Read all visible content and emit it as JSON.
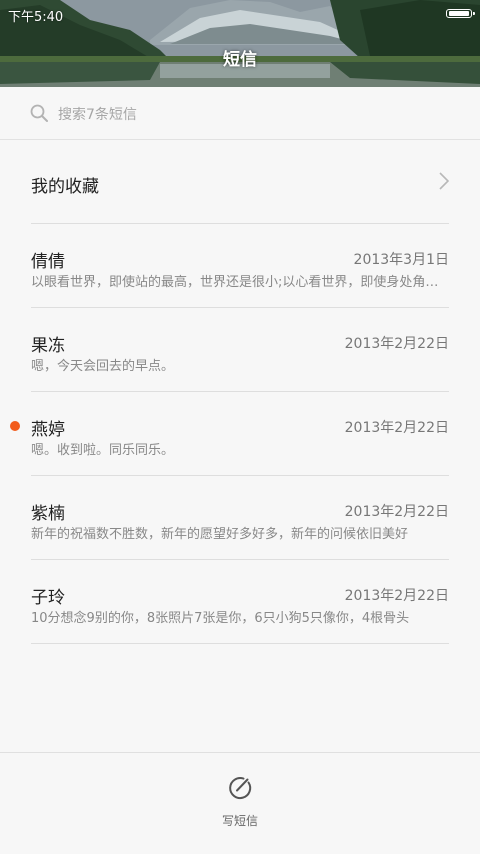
{
  "status": {
    "time": "下午5:40"
  },
  "header": {
    "title": "短信"
  },
  "search": {
    "placeholder": "搜索7条短信"
  },
  "favorites": {
    "label": "我的收藏"
  },
  "threads": [
    {
      "name": "倩倩",
      "date": "2013年3月1日",
      "preview": "以眼看世界，即使站的最高，世界还是很小;以心看世界，即使身处角落，世界也很大",
      "unread": false
    },
    {
      "name": "果冻",
      "date": "2013年2月22日",
      "preview": "嗯，今天会回去的早点。",
      "unread": false
    },
    {
      "name": "燕婷",
      "date": "2013年2月22日",
      "preview": "嗯。收到啦。同乐同乐。",
      "unread": true
    },
    {
      "name": "紫楠",
      "date": "2013年2月22日",
      "preview": "新年的祝福数不胜数，新年的愿望好多好多，新年的问候依旧美好",
      "unread": false
    },
    {
      "name": "子玲",
      "date": "2013年2月22日",
      "preview": "10分想念9别的你，8张照片7张是你，6只小狗5只像你，4根骨头",
      "unread": false
    }
  ],
  "bottom": {
    "compose_label": "写短信"
  },
  "colors": {
    "unread_dot": "#f25c1c"
  }
}
